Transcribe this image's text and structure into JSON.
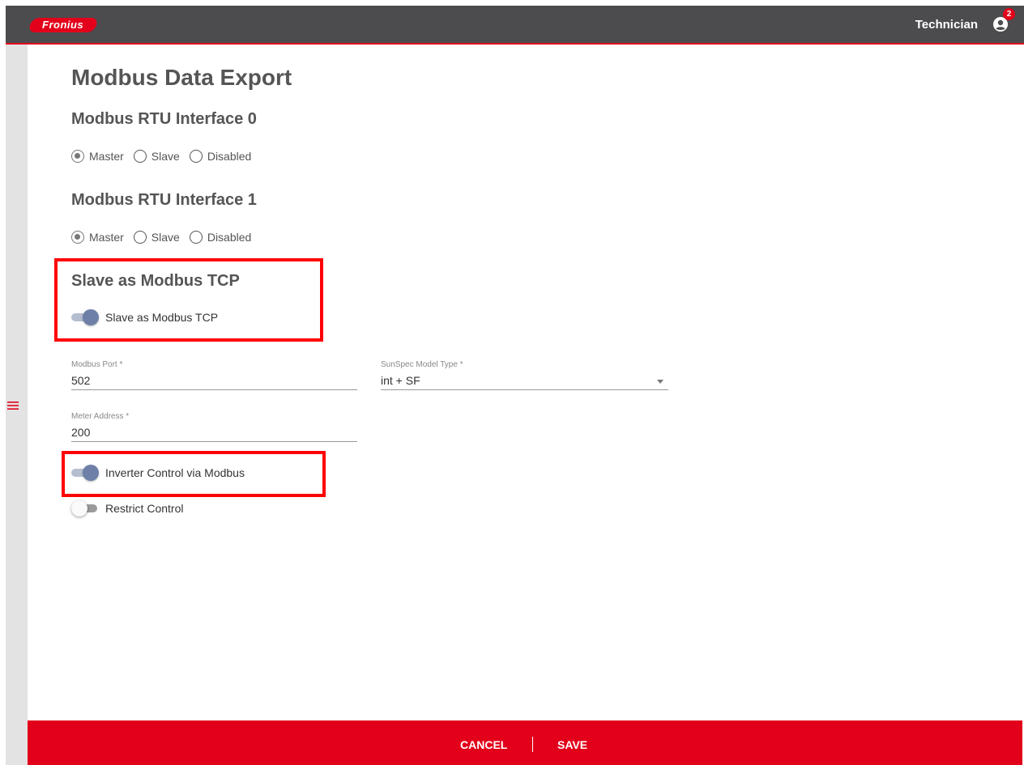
{
  "header": {
    "logo_text": "Fronius",
    "user_label": "Technician",
    "notification_count": "2",
    "brand_color": "#e2001a"
  },
  "page": {
    "title": "Modbus Data Export"
  },
  "rtu0": {
    "title": "Modbus RTU Interface 0",
    "options": [
      "Master",
      "Slave",
      "Disabled"
    ],
    "selected": "Master"
  },
  "rtu1": {
    "title": "Modbus RTU Interface 1",
    "options": [
      "Master",
      "Slave",
      "Disabled"
    ],
    "selected": "Master"
  },
  "tcp": {
    "title": "Slave as Modbus TCP",
    "toggle_label": "Slave as Modbus TCP",
    "toggle_on": true
  },
  "fields": {
    "port_label": "Modbus Port *",
    "port_value": "502",
    "model_label": "SunSpec Model Type *",
    "model_value": "int + SF",
    "meter_label": "Meter Address *",
    "meter_value": "200"
  },
  "controls": {
    "inverter_label": "Inverter Control via Modbus",
    "inverter_on": true,
    "restrict_label": "Restrict Control",
    "restrict_on": false
  },
  "footer": {
    "cancel": "CANCEL",
    "save": "SAVE"
  },
  "icons": {
    "user": "user-circle-icon",
    "menu": "hamburger-menu-icon",
    "dropdown": "chevron-down-icon"
  }
}
